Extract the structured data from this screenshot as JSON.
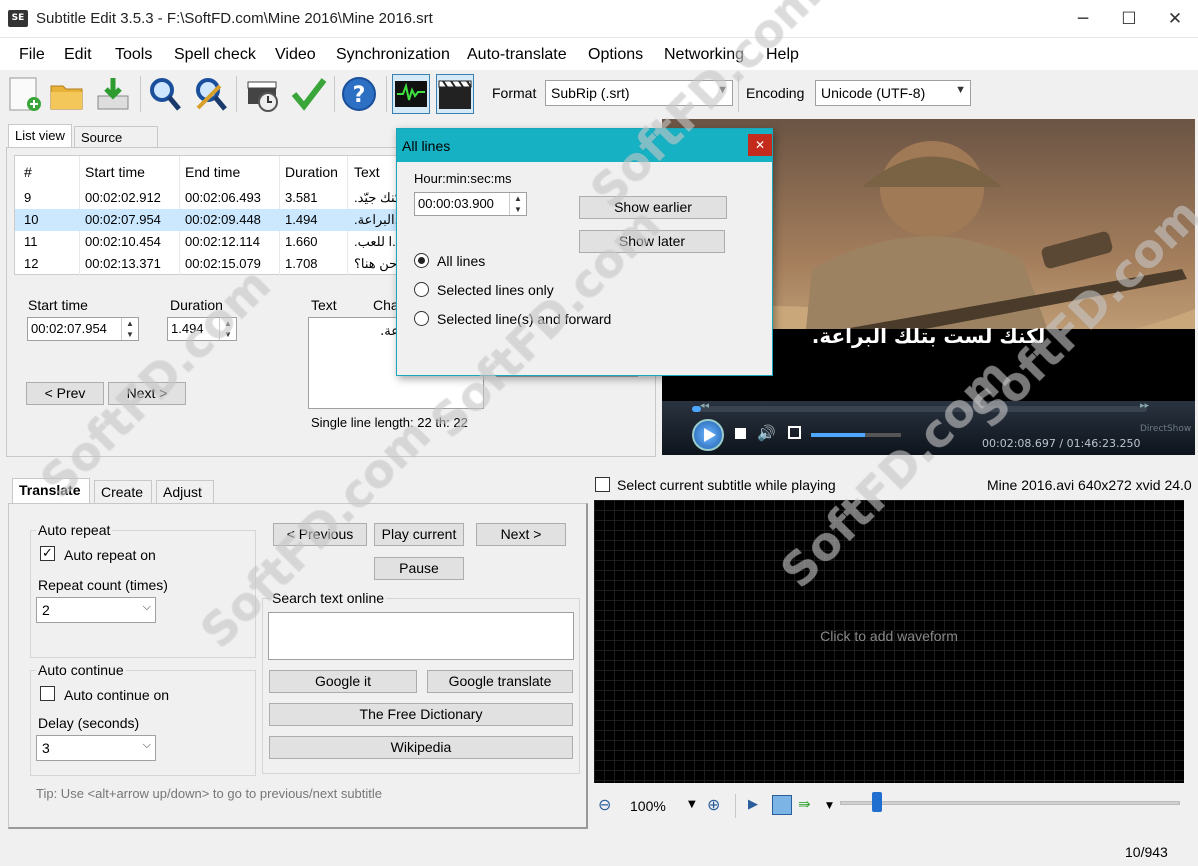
{
  "app": {
    "icon_label": "SE",
    "title": "Subtitle Edit 3.5.3 - F:\\SoftFD.com\\Mine 2016\\Mine 2016.srt"
  },
  "window_controls": {
    "minimize": "─",
    "maximize": "☐",
    "close": "✕"
  },
  "menu": [
    "File",
    "Edit",
    "Tools",
    "Spell check",
    "Video",
    "Synchronization",
    "Auto-translate",
    "Options",
    "Networking",
    "Help"
  ],
  "toolbar": {
    "format_label": "Format",
    "format_value": "SubRip (.srt)",
    "encoding_label": "Encoding",
    "encoding_value": "Unicode (UTF-8)",
    "icons": [
      "new-file-icon",
      "open-folder-icon",
      "save-download-icon",
      "find-icon",
      "replace-icon",
      "visual-sync-icon",
      "spell-check-icon",
      "help-icon",
      "waveform-toggle-icon",
      "video-toggle-icon"
    ]
  },
  "list_tabs": {
    "list_view": "List view",
    "source_view": "Source view"
  },
  "grid": {
    "headers": [
      "#",
      "Start time",
      "End time",
      "Duration",
      "Text"
    ],
    "rows": [
      {
        "num": "9",
        "start": "00:02:02.912",
        "end": "00:02:06.493",
        "dur": "3.581",
        "text": "...كنك جيّد."
      },
      {
        "num": "10",
        "start": "00:02:07.954",
        "end": "00:02:09.448",
        "dur": "1.494",
        "text": "...البراعة."
      },
      {
        "num": "11",
        "start": "00:02:10.454",
        "end": "00:02:12.114",
        "dur": "1.660",
        "text": "...ا للعب."
      },
      {
        "num": "12",
        "start": "00:02:13.371",
        "end": "00:02:15.079",
        "dur": "1.708",
        "text": "...حن هنا؟"
      }
    ],
    "selected_index": 1
  },
  "edit": {
    "start_label": "Start time",
    "start_value": "00:02:07.954",
    "duration_label": "Duration",
    "duration_value": "1.494",
    "text_label": "Text",
    "chars_label": "Cha",
    "text_value": "...ت بتلك البراعة.",
    "prev": "< Prev",
    "next": "Next >",
    "line_info": "Single line length: 22  th: 22"
  },
  "dialog": {
    "title": "All lines",
    "close": "✕",
    "time_label": "Hour:min:sec:ms",
    "time_value": "00:00:03.900",
    "show_earlier": "Show earlier",
    "show_later": "Show later",
    "options": [
      "All lines",
      "Selected lines only",
      "Selected line(s) and forward"
    ],
    "selected_option": 0
  },
  "video": {
    "subtitle": "لكنك لست بتلك البراعة.",
    "position": "00:02:08.697 / 01:46:23.250",
    "directshow": "DirectShow",
    "progress": 0.02,
    "volume": 0.6
  },
  "bottom_tabs": [
    "Translate",
    "Create",
    "Adjust"
  ],
  "translate": {
    "auto_repeat_group": "Auto repeat",
    "auto_repeat_on": "Auto repeat on",
    "auto_repeat_checked": true,
    "repeat_count_label": "Repeat count (times)",
    "repeat_count_value": "2",
    "auto_continue_group": "Auto continue",
    "auto_continue_on": "Auto continue on",
    "auto_continue_checked": false,
    "delay_label": "Delay (seconds)",
    "delay_value": "3",
    "previous": "< Previous",
    "play_current": "Play current",
    "next": "Next >",
    "pause": "Pause",
    "search_group": "Search text online",
    "google_it": "Google it",
    "google_translate": "Google translate",
    "free_dictionary": "The Free Dictionary",
    "wikipedia": "Wikipedia",
    "tip": "Tip: Use <alt+arrow up/down> to go to previous/next subtitle"
  },
  "waveform": {
    "select_current": "Select current subtitle while playing",
    "select_checked": false,
    "video_info": "Mine 2016.avi 640x272 xvid 24.0",
    "placeholder": "Click to add waveform",
    "zoom": "100%"
  },
  "status": {
    "count": "10/943"
  },
  "watermark": "SoftFD.com"
}
